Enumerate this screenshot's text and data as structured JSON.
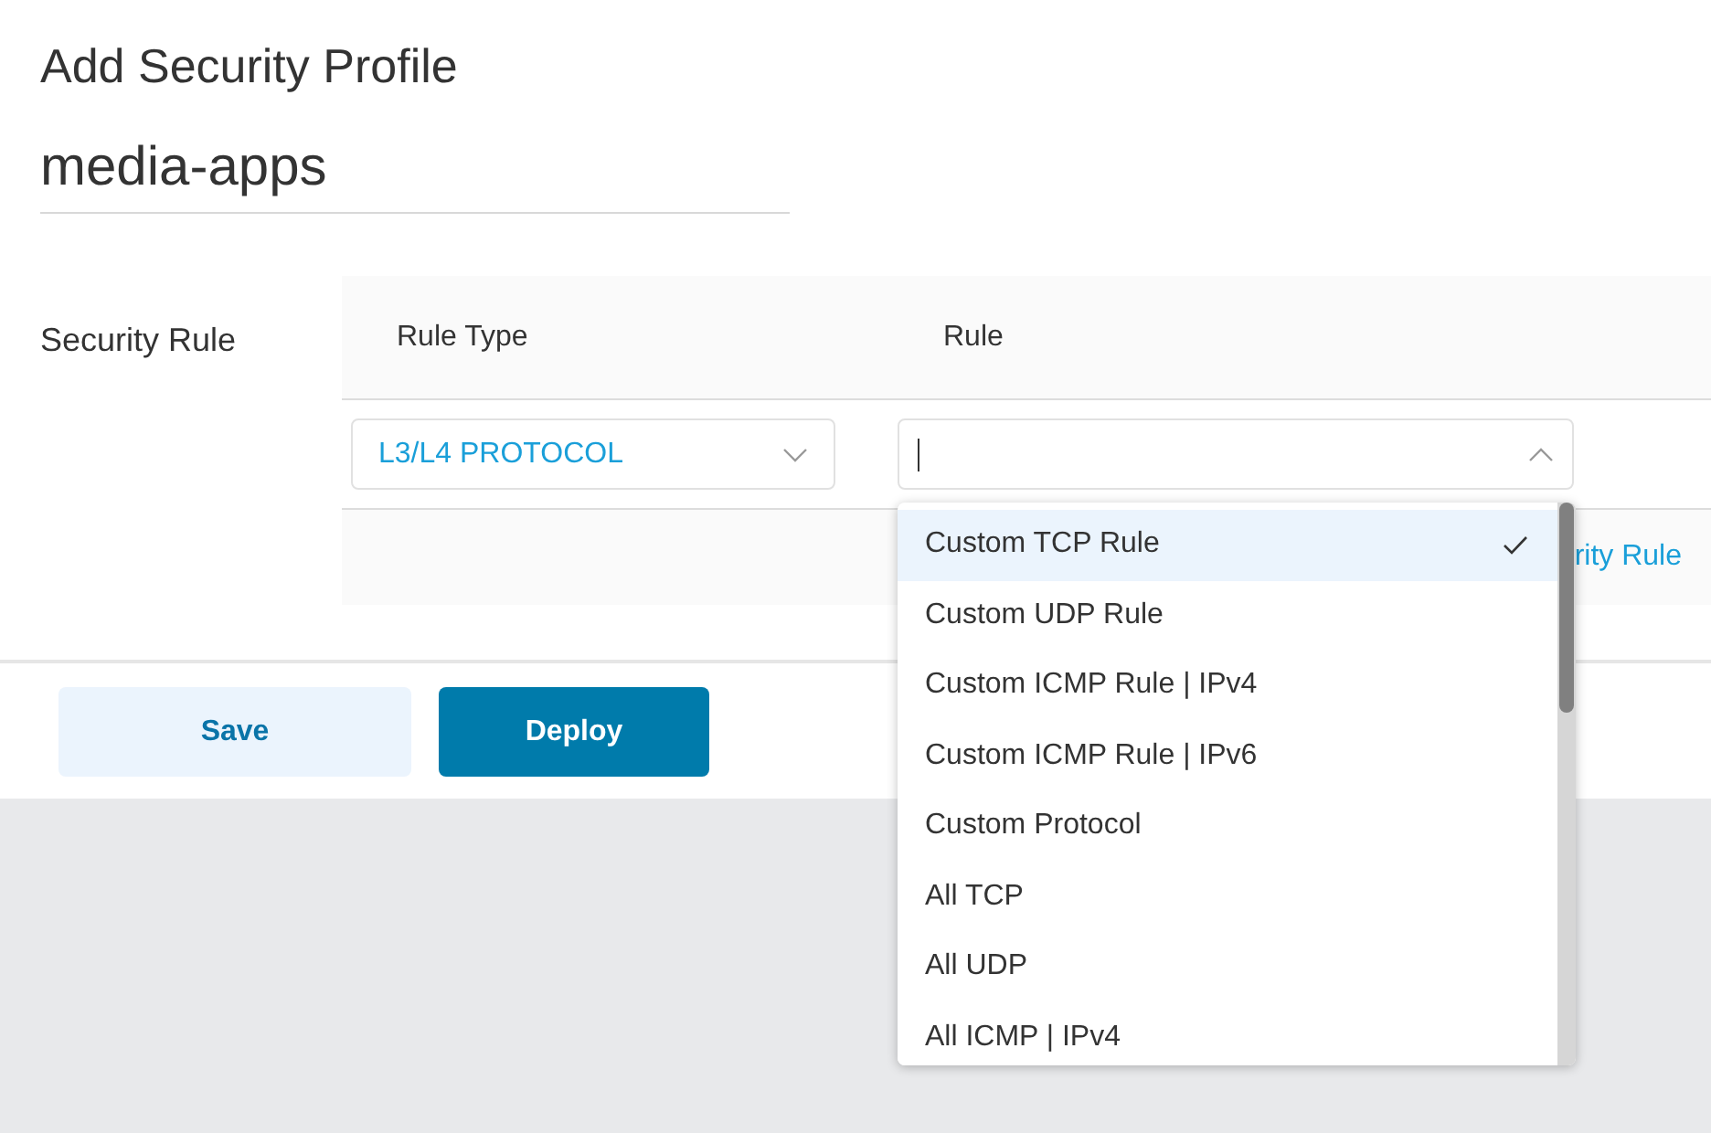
{
  "title": "Add Security Profile",
  "profile_name": {
    "value": "media-apps"
  },
  "security_rule": {
    "label": "Security Rule",
    "columns": [
      "Rule Type",
      "Rule"
    ],
    "rule_type": {
      "value": "L3/L4 PROTOCOL"
    },
    "rule": {
      "expanded": true,
      "options": [
        {
          "label": "Custom TCP Rule",
          "selected": true
        },
        {
          "label": "Custom UDP Rule",
          "selected": false
        },
        {
          "label": "Custom ICMP Rule | IPv4",
          "selected": false
        },
        {
          "label": "Custom ICMP Rule | IPv6",
          "selected": false
        },
        {
          "label": "Custom Protocol",
          "selected": false
        },
        {
          "label": "All TCP",
          "selected": false
        },
        {
          "label": "All UDP",
          "selected": false
        },
        {
          "label": "All ICMP | IPv4",
          "selected": false
        }
      ]
    },
    "add_link": "rity Rule"
  },
  "buttons": [
    {
      "label": "Save",
      "kind": "secondary"
    },
    {
      "label": "Deploy",
      "kind": "primary"
    }
  ]
}
